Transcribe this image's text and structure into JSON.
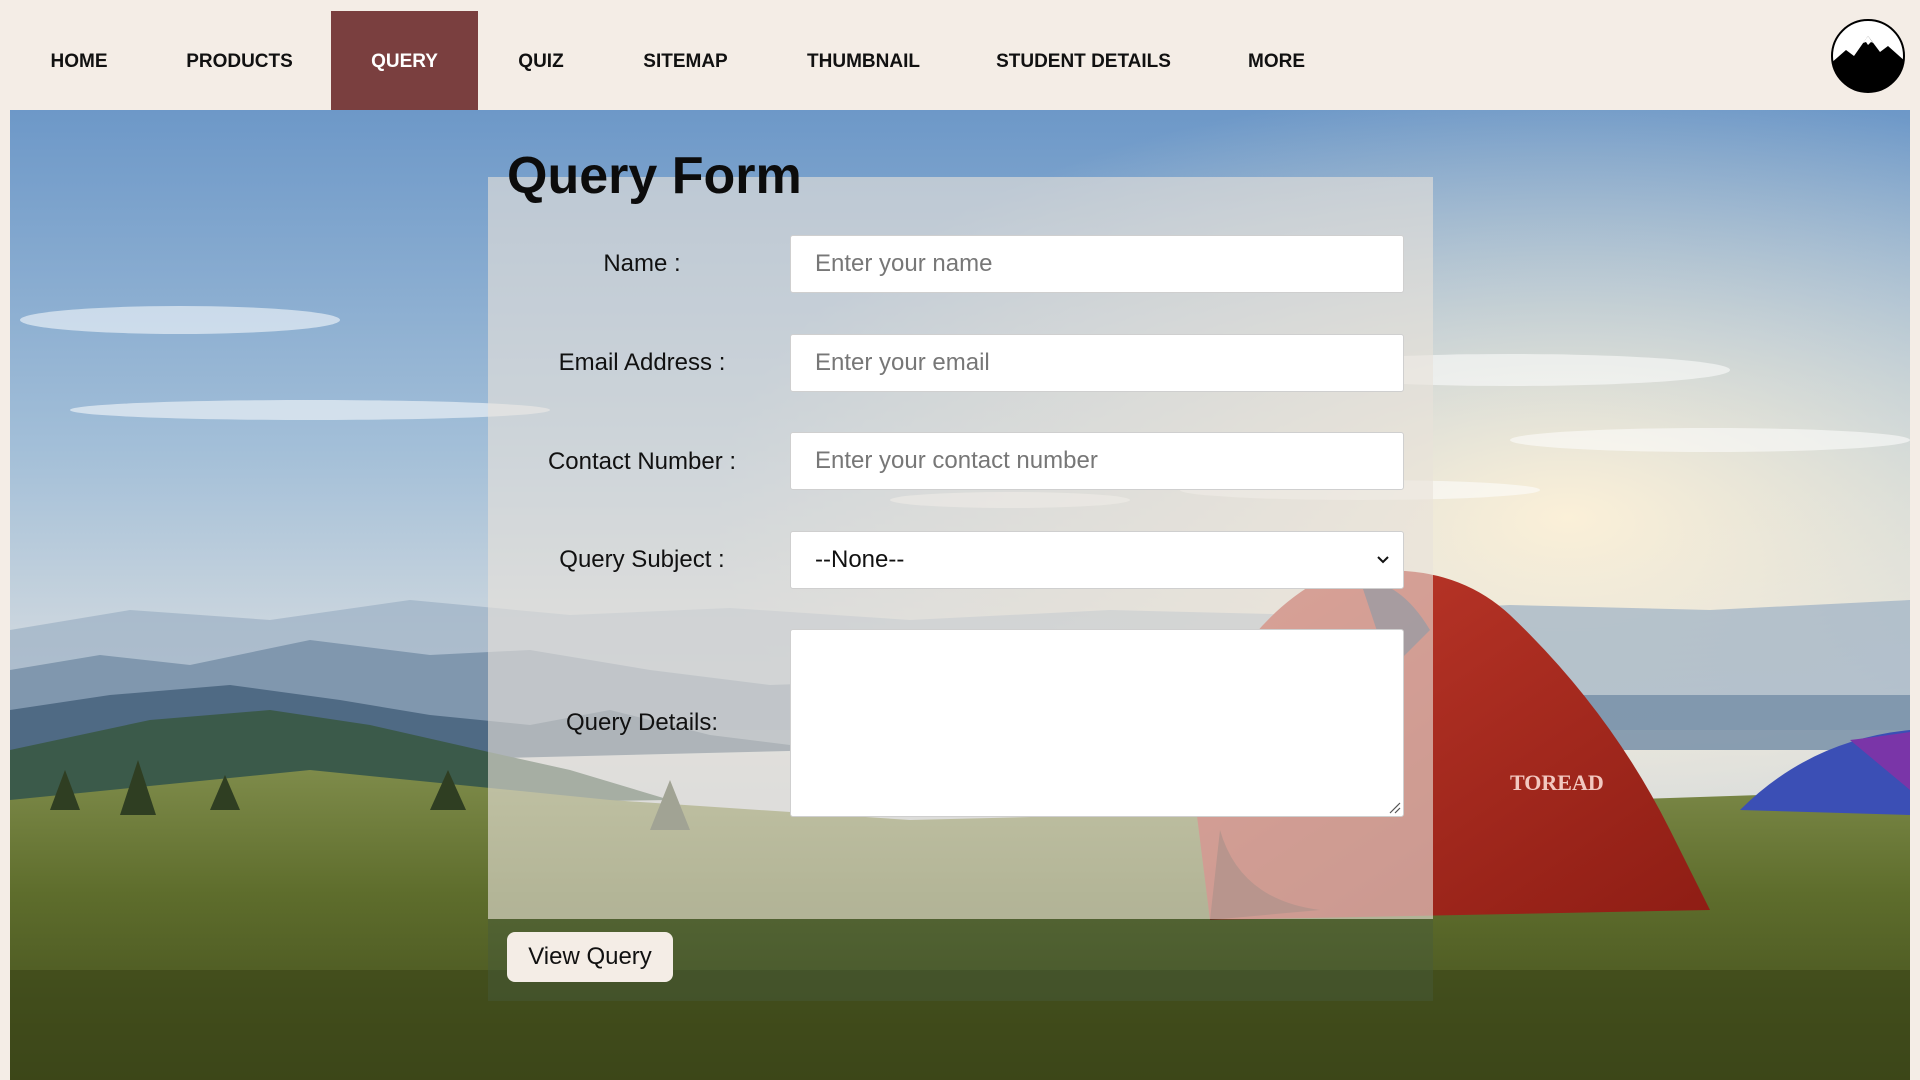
{
  "nav": {
    "items": [
      {
        "label": "HOME"
      },
      {
        "label": "PRODUCTS"
      },
      {
        "label": "QUERY"
      },
      {
        "label": "QUIZ"
      },
      {
        "label": "SITEMAP"
      },
      {
        "label": "THUMBNAIL"
      },
      {
        "label": "STUDENT DETAILS"
      },
      {
        "label": "MORE"
      }
    ],
    "active": "QUERY",
    "active_color": "#7a3f3f"
  },
  "logo": {
    "icon": "mountain-logo-icon"
  },
  "form": {
    "title": "Query Form",
    "name_label": "Name :",
    "name_placeholder": "Enter your name",
    "email_label": "Email Address :",
    "email_placeholder": "Enter your email",
    "contact_label": "Contact Number :",
    "contact_placeholder": "Enter your contact number",
    "subject_label": "Query Subject :",
    "subject_value": "--None--",
    "details_label": "Query Details:",
    "submit_label": "View Query"
  },
  "background": {
    "tent_brand": "TOREAD"
  }
}
